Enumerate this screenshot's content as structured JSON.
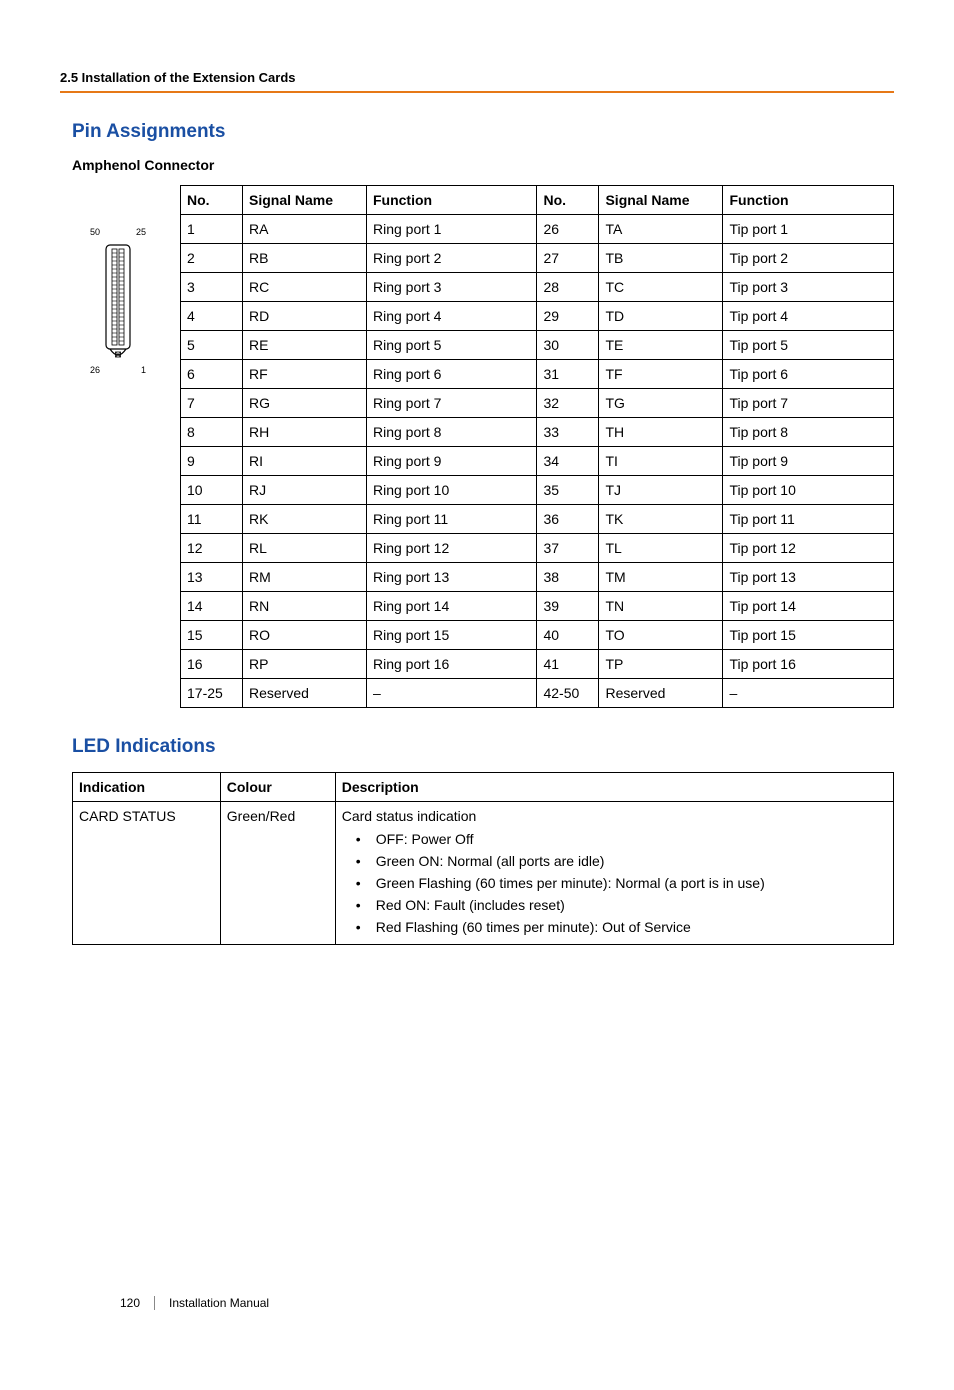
{
  "header": {
    "section_label": "2.5 Installation of the Extension Cards"
  },
  "pin_assignments": {
    "title": "Pin Assignments",
    "connector_title": "Amphenol Connector",
    "connector_labels": {
      "top_left": "50",
      "top_right": "25",
      "bottom_left": "26",
      "bottom_right": "1"
    },
    "columns": {
      "no": "No.",
      "signal": "Signal Name",
      "function": "Function"
    },
    "rows": [
      {
        "n1": "1",
        "s1": "RA",
        "f1": "Ring port 1",
        "n2": "26",
        "s2": "TA",
        "f2": "Tip port 1"
      },
      {
        "n1": "2",
        "s1": "RB",
        "f1": "Ring port 2",
        "n2": "27",
        "s2": "TB",
        "f2": "Tip port 2"
      },
      {
        "n1": "3",
        "s1": "RC",
        "f1": "Ring port 3",
        "n2": "28",
        "s2": "TC",
        "f2": "Tip port 3"
      },
      {
        "n1": "4",
        "s1": "RD",
        "f1": "Ring port 4",
        "n2": "29",
        "s2": "TD",
        "f2": "Tip port 4"
      },
      {
        "n1": "5",
        "s1": "RE",
        "f1": "Ring port 5",
        "n2": "30",
        "s2": "TE",
        "f2": "Tip port 5"
      },
      {
        "n1": "6",
        "s1": "RF",
        "f1": "Ring port 6",
        "n2": "31",
        "s2": "TF",
        "f2": "Tip port 6"
      },
      {
        "n1": "7",
        "s1": "RG",
        "f1": "Ring port 7",
        "n2": "32",
        "s2": "TG",
        "f2": "Tip port 7"
      },
      {
        "n1": "8",
        "s1": "RH",
        "f1": "Ring port 8",
        "n2": "33",
        "s2": "TH",
        "f2": "Tip port 8"
      },
      {
        "n1": "9",
        "s1": "RI",
        "f1": "Ring port 9",
        "n2": "34",
        "s2": "TI",
        "f2": "Tip port 9"
      },
      {
        "n1": "10",
        "s1": "RJ",
        "f1": "Ring port 10",
        "n2": "35",
        "s2": "TJ",
        "f2": "Tip port 10"
      },
      {
        "n1": "11",
        "s1": "RK",
        "f1": "Ring port 11",
        "n2": "36",
        "s2": "TK",
        "f2": "Tip port 11"
      },
      {
        "n1": "12",
        "s1": "RL",
        "f1": "Ring port 12",
        "n2": "37",
        "s2": "TL",
        "f2": "Tip port 12"
      },
      {
        "n1": "13",
        "s1": "RM",
        "f1": "Ring port 13",
        "n2": "38",
        "s2": "TM",
        "f2": "Tip port 13"
      },
      {
        "n1": "14",
        "s1": "RN",
        "f1": "Ring port 14",
        "n2": "39",
        "s2": "TN",
        "f2": "Tip port 14"
      },
      {
        "n1": "15",
        "s1": "RO",
        "f1": "Ring port 15",
        "n2": "40",
        "s2": "TO",
        "f2": "Tip port 15"
      },
      {
        "n1": "16",
        "s1": "RP",
        "f1": "Ring port 16",
        "n2": "41",
        "s2": "TP",
        "f2": "Tip port 16"
      },
      {
        "n1": "17-25",
        "s1": "Reserved",
        "f1": "–",
        "n2": "42-50",
        "s2": "Reserved",
        "f2": "–"
      }
    ]
  },
  "led": {
    "title": "LED Indications",
    "columns": {
      "indication": "Indication",
      "colour": "Colour",
      "description": "Description"
    },
    "row": {
      "indication": "CARD STATUS",
      "colour": "Green/Red",
      "desc_intro": "Card status indication",
      "items": [
        "OFF: Power Off",
        "Green ON: Normal (all ports are idle)",
        "Green Flashing (60 times per minute): Normal (a port is in use)",
        "Red ON: Fault (includes reset)",
        "Red Flashing (60 times per minute): Out of Service"
      ]
    }
  },
  "footer": {
    "page_number": "120",
    "doc_title": "Installation Manual"
  }
}
